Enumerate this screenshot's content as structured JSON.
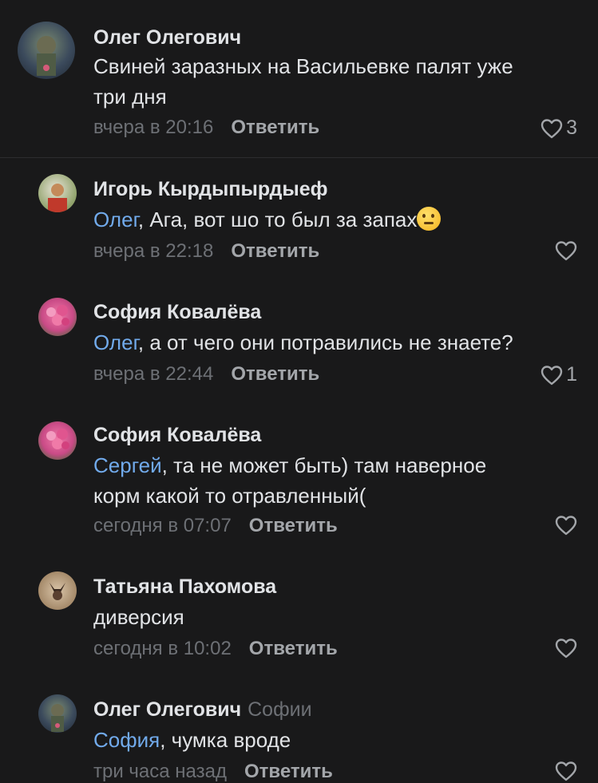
{
  "comments": [
    {
      "author": "Олег Олегович",
      "reply_to": "",
      "mention": "",
      "text_line1": "Свиней заразных на Васильевке палят уже",
      "text_line2": "три дня",
      "time": "вчера в 20:16",
      "reply_label": "Ответить",
      "likes": "3",
      "avatar_color": "#3b4a5c"
    },
    {
      "author": "Игорь Кырдыпырдыеф",
      "reply_to": "",
      "mention": "Олег",
      "text_line1": ", Ага, вот шо то был за запах",
      "text_line2": "",
      "emoji": "thinking-face",
      "time": "вчера в 22:18",
      "reply_label": "Ответить",
      "likes": "",
      "avatar_color": "#8fa16a"
    },
    {
      "author": "София Ковалёва",
      "reply_to": "",
      "mention": "Олег",
      "text_line1": ", а от чего они потравились не знаете?",
      "text_line2": "",
      "time": "вчера в 22:44",
      "reply_label": "Ответить",
      "likes": "1",
      "avatar_color": "#c94a86"
    },
    {
      "author": "София Ковалёва",
      "reply_to": "",
      "mention": "Сергей",
      "text_line1": ", та не может быть) там наверное",
      "text_line2": "корм какой то отравленный(",
      "time": "сегодня в 07:07",
      "reply_label": "Ответить",
      "likes": "",
      "avatar_color": "#c94a86"
    },
    {
      "author": "Татьяна Пахомова",
      "reply_to": "",
      "mention": "",
      "text_line1": "диверсия",
      "text_line2": "",
      "time": "сегодня в 10:02",
      "reply_label": "Ответить",
      "likes": "",
      "avatar_color": "#a58a6a"
    },
    {
      "author": "Олег Олегович",
      "reply_to": "Софии",
      "mention": "София",
      "text_line1": ", чумка вроде",
      "text_line2": "",
      "time": "три часа назад",
      "reply_label": "Ответить",
      "likes": "",
      "avatar_color": "#3b4a5c"
    }
  ],
  "colors": {
    "background": "#19191a",
    "text": "#e1e3e6",
    "mention": "#71aaeb",
    "secondary": "#6d7075"
  }
}
